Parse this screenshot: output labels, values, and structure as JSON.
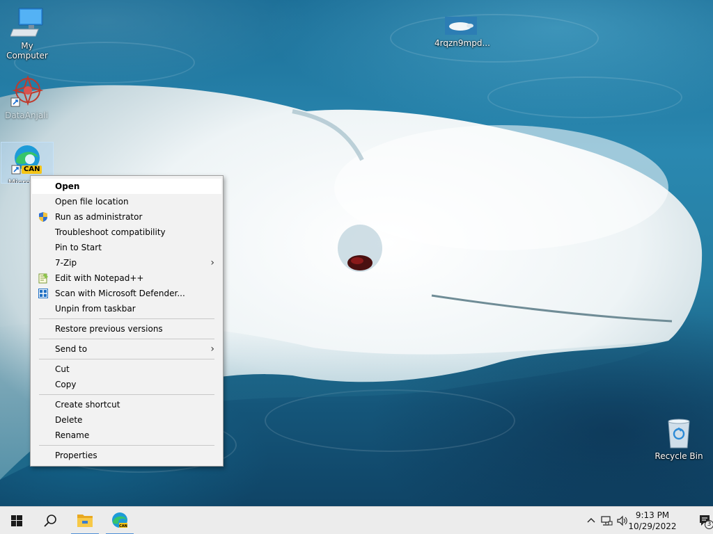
{
  "desktop": {
    "icons": [
      {
        "label": "My Computer",
        "icon": "computer-icon"
      },
      {
        "label": "4rqzn9mpd...",
        "icon": "image-file-icon"
      },
      {
        "label": "DataAnjali",
        "icon": "app-shortcut-icon"
      },
      {
        "label": "Microsoft Edge Canary",
        "icon": "edge-canary-icon",
        "badge": "CAN"
      },
      {
        "label": "Recycle Bin",
        "icon": "recycle-bin-icon"
      }
    ]
  },
  "context_menu": {
    "items": [
      {
        "label": "Open"
      },
      {
        "label": "Open file location"
      },
      {
        "label": "Run as administrator",
        "icon": "shield-icon"
      },
      {
        "label": "Troubleshoot compatibility"
      },
      {
        "label": "Pin to Start"
      },
      {
        "label": "7-Zip"
      },
      {
        "label": "Edit with Notepad++",
        "icon": "notepad-plus-icon"
      },
      {
        "label": "Scan with Microsoft Defender...",
        "icon": "defender-icon"
      },
      {
        "label": "Unpin from taskbar"
      },
      {
        "label": "Restore previous versions"
      },
      {
        "label": "Send to"
      },
      {
        "label": "Cut"
      },
      {
        "label": "Copy"
      },
      {
        "label": "Create shortcut"
      },
      {
        "label": "Delete"
      },
      {
        "label": "Rename"
      },
      {
        "label": "Properties"
      }
    ]
  },
  "taskbar": {
    "clock_time": "9:13 PM",
    "clock_date": "10/29/2022",
    "notification_count": "3"
  },
  "colors": {
    "menu_bg": "#f2f2f2",
    "taskbar_bg": "#ececec",
    "accent": "#4f8fd6",
    "canary_badge": "#f5c518"
  }
}
